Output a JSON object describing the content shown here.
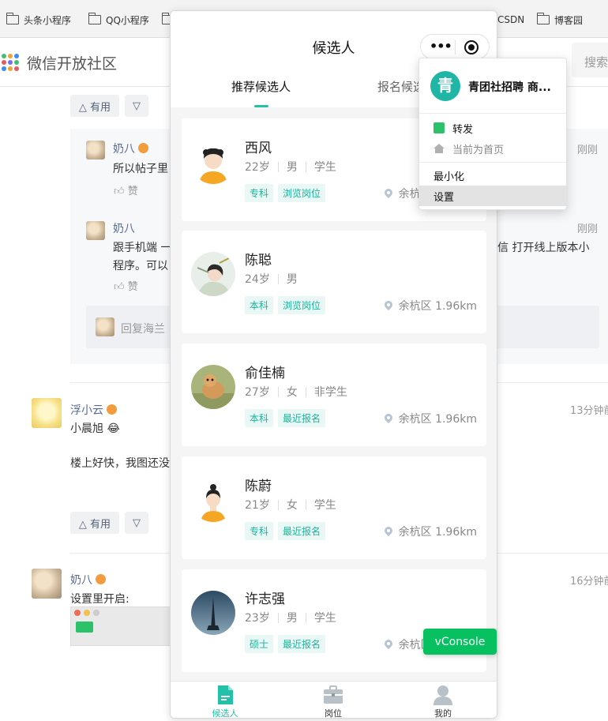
{
  "bookmarks": [
    "头条小程序",
    "QQ小程序",
    "CSDN",
    "博客园"
  ],
  "community": {
    "logo_text": "微信开放社区",
    "search_placeholder": "搜索"
  },
  "forum": {
    "vote_up": "△ 有用",
    "vote_down": "▽",
    "like": "赞",
    "reply_placeholder": "回复海兰",
    "replies": [
      {
        "user": "奶八",
        "text": "所以帖子里",
        "time": "刚刚"
      },
      {
        "user": "奶八",
        "text_line1": "跟手机端 一",
        "text_line1_right": "信 打开线上版本小",
        "text_line2": "程序。可以",
        "time": "刚刚"
      }
    ],
    "posts": [
      {
        "user": "浮小云",
        "text": "小晨旭 😂",
        "extra": "楼上好快，我图还没",
        "time": "13分钟前"
      },
      {
        "user": "奶八",
        "text": "设置里开启:",
        "time": "16分钟前"
      }
    ]
  },
  "phone": {
    "title": "候选人",
    "tabs": [
      {
        "label": "推荐候选人",
        "active": true
      },
      {
        "label": "报名候选人",
        "active": false
      }
    ],
    "candidates": [
      {
        "name": "西风",
        "age": "22岁",
        "gender": "男",
        "status": "学生",
        "tags": [
          "专科",
          "浏览岗位"
        ],
        "location": "余杭区 1.96km",
        "avatar": "male-cartoon"
      },
      {
        "name": "陈聪",
        "age": "24岁",
        "gender": "男",
        "status": "",
        "tags": [
          "本科",
          "浏览岗位"
        ],
        "location": "余杭区 1.96km",
        "avatar": "anime-girl"
      },
      {
        "name": "俞佳楠",
        "age": "27岁",
        "gender": "女",
        "status": "非学生",
        "tags": [
          "本科",
          "最近报名"
        ],
        "location": "余杭区 1.96km",
        "avatar": "dog-photo"
      },
      {
        "name": "陈蔚",
        "age": "21岁",
        "gender": "女",
        "status": "学生",
        "tags": [
          "专科",
          "最近报名"
        ],
        "location": "余杭区 1.96km",
        "avatar": "female-cartoon"
      },
      {
        "name": "许志强",
        "age": "23岁",
        "gender": "男",
        "status": "学生",
        "tags": [
          "硕士",
          "最近报名"
        ],
        "location": "余杭区 1.96km",
        "avatar": "tower-photo"
      }
    ],
    "tabbar": [
      {
        "label": "候选人",
        "active": true,
        "icon": "document-icon"
      },
      {
        "label": "岗位",
        "active": false,
        "icon": "briefcase-icon"
      },
      {
        "label": "我的",
        "active": false,
        "icon": "person-icon"
      }
    ],
    "vconsole": "vConsole"
  },
  "menu": {
    "app_name": "青团社招聘 商...",
    "logo_char": "青",
    "items": {
      "forward": "转发",
      "home": "当前为首页",
      "minimize": "最小化",
      "settings": "设置"
    }
  },
  "colors": {
    "accent": "#23c1a8",
    "tag_text": "#17b59c",
    "tag_bg": "#e9f8f5",
    "vconsole": "#07c160"
  }
}
